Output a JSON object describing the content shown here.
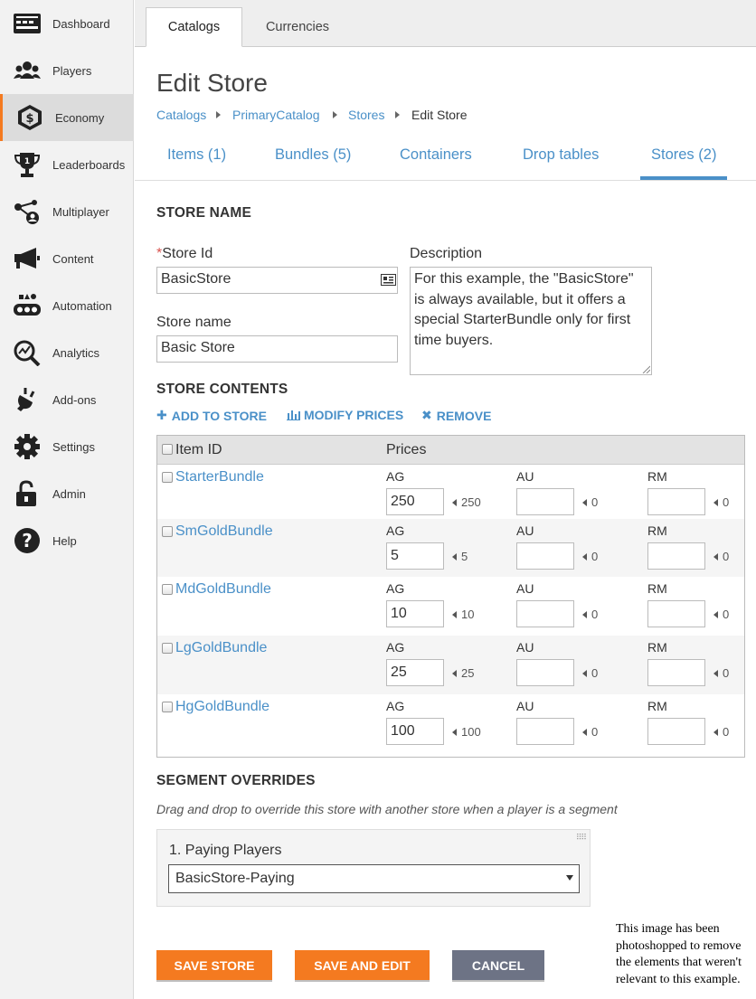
{
  "sidebar": {
    "items": [
      {
        "label": "Dashboard",
        "icon": "dashboard-icon"
      },
      {
        "label": "Players",
        "icon": "players-icon"
      },
      {
        "label": "Economy",
        "icon": "economy-icon"
      },
      {
        "label": "Leaderboards",
        "icon": "leaderboards-icon"
      },
      {
        "label": "Multiplayer",
        "icon": "multiplayer-icon"
      },
      {
        "label": "Content",
        "icon": "content-icon"
      },
      {
        "label": "Automation",
        "icon": "automation-icon"
      },
      {
        "label": "Analytics",
        "icon": "analytics-icon"
      },
      {
        "label": "Add-ons",
        "icon": "addons-icon"
      },
      {
        "label": "Settings",
        "icon": "settings-icon"
      },
      {
        "label": "Admin",
        "icon": "admin-icon"
      },
      {
        "label": "Help",
        "icon": "help-icon"
      }
    ],
    "active": "Economy"
  },
  "top_tabs": [
    {
      "label": "Catalogs",
      "active": true
    },
    {
      "label": "Currencies",
      "active": false
    }
  ],
  "page": {
    "title": "Edit Store",
    "breadcrumb": [
      "Catalogs",
      "PrimaryCatalog",
      "Stores",
      "Edit Store"
    ]
  },
  "sub_tabs": [
    {
      "label": "Items (1)"
    },
    {
      "label": "Bundles (5)"
    },
    {
      "label": "Containers"
    },
    {
      "label": "Drop tables"
    },
    {
      "label": "Stores (2)",
      "active": true
    }
  ],
  "store_name": {
    "heading": "STORE NAME",
    "store_id_label": "Store Id",
    "store_id_required_mark": "*",
    "store_id_value": "BasicStore",
    "store_name_label": "Store name",
    "store_name_value": "Basic Store",
    "description_label": "Description",
    "description_value": "For this example, the \"BasicStore\" is always available, but it offers a special StarterBundle only for first time buyers."
  },
  "store_contents": {
    "heading": "STORE CONTENTS",
    "actions": {
      "add": "ADD TO STORE",
      "modify": "MODIFY PRICES",
      "remove": "REMOVE"
    },
    "columns": {
      "item_id": "Item ID",
      "prices": "Prices"
    },
    "currencies": [
      "AG",
      "AU",
      "RM"
    ],
    "rows": [
      {
        "item": "StarterBundle",
        "prices": [
          {
            "value": "250",
            "base": "250"
          },
          {
            "value": "",
            "base": "0"
          },
          {
            "value": "",
            "base": "0"
          }
        ]
      },
      {
        "item": "SmGoldBundle",
        "prices": [
          {
            "value": "5",
            "base": "5"
          },
          {
            "value": "",
            "base": "0"
          },
          {
            "value": "",
            "base": "0"
          }
        ]
      },
      {
        "item": "MdGoldBundle",
        "prices": [
          {
            "value": "10",
            "base": "10"
          },
          {
            "value": "",
            "base": "0"
          },
          {
            "value": "",
            "base": "0"
          }
        ]
      },
      {
        "item": "LgGoldBundle",
        "prices": [
          {
            "value": "25",
            "base": "25"
          },
          {
            "value": "",
            "base": "0"
          },
          {
            "value": "",
            "base": "0"
          }
        ]
      },
      {
        "item": "HgGoldBundle",
        "prices": [
          {
            "value": "100",
            "base": "100"
          },
          {
            "value": "",
            "base": "0"
          },
          {
            "value": "",
            "base": "0"
          }
        ]
      }
    ]
  },
  "segment_overrides": {
    "heading": "SEGMENT OVERRIDES",
    "hint": "Drag and drop to override this store with another store when a player is a segment",
    "override_title": "1. Paying Players",
    "override_selected": "BasicStore-Paying"
  },
  "buttons": {
    "save": "SAVE STORE",
    "save_edit": "SAVE AND EDIT",
    "cancel": "CANCEL"
  },
  "note": "This image has been photoshopped to remove the elements that weren't relevant to this example.",
  "colors": {
    "accent": "#f47a20",
    "link": "#4a90c8",
    "cancel": "#6d7385"
  }
}
